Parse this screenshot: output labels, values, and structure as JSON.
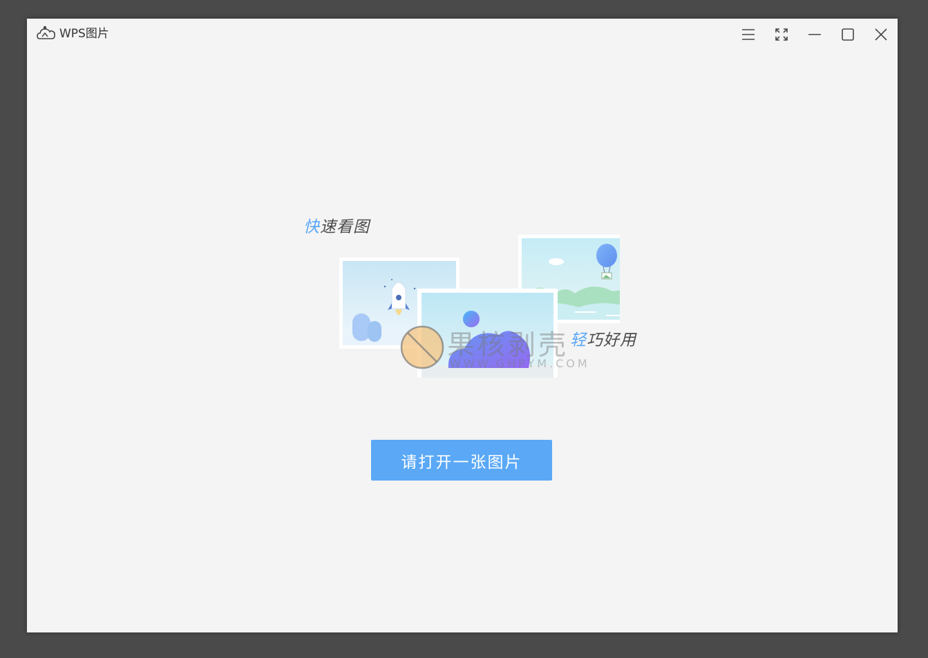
{
  "app": {
    "title": "WPS图片",
    "logo_icon": "cloud-camera-icon"
  },
  "title_controls": [
    {
      "name": "menu-button",
      "icon": "hamburger-menu-icon"
    },
    {
      "name": "fullscreen-button",
      "icon": "fullscreen-icon"
    },
    {
      "name": "minimize-button",
      "icon": "minimize-icon"
    },
    {
      "name": "maximize-button",
      "icon": "maximize-icon"
    },
    {
      "name": "close-button",
      "icon": "close-icon"
    }
  ],
  "welcome": {
    "tagline_left_accent": "快",
    "tagline_left_rest": "速看图",
    "tagline_right_accent": "轻",
    "tagline_right_rest": "巧好用",
    "open_button_label": "请打开一张图片"
  },
  "watermark": {
    "title": "果核剥壳",
    "url": "WWW.GHPYM.COM"
  },
  "colors": {
    "accent": "#5aa8f6",
    "background": "#f4f4f4",
    "desktop": "#4a4a4a"
  }
}
